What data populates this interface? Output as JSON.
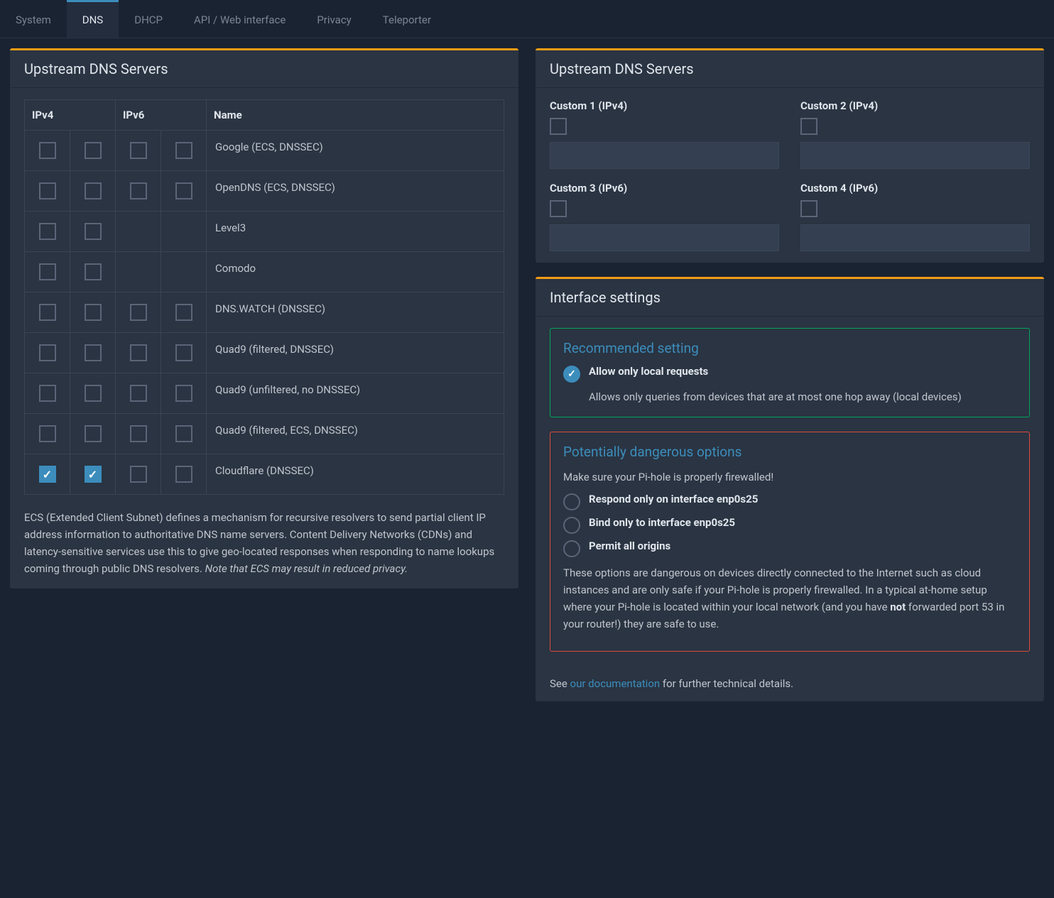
{
  "tabs": [
    {
      "label": "System",
      "active": false
    },
    {
      "label": "DNS",
      "active": true
    },
    {
      "label": "DHCP",
      "active": false
    },
    {
      "label": "API / Web interface",
      "active": false
    },
    {
      "label": "Privacy",
      "active": false
    },
    {
      "label": "Teleporter",
      "active": false
    }
  ],
  "upstream_card": {
    "title": "Upstream DNS Servers",
    "headers": {
      "ipv4": "IPv4",
      "ipv6": "IPv6",
      "name": "Name"
    },
    "providers": [
      {
        "name": "Google (ECS, DNSSEC)",
        "ipv4a": false,
        "ipv4b": false,
        "ipv6a": false,
        "ipv6b": false,
        "has_ipv6": true
      },
      {
        "name": "OpenDNS (ECS, DNSSEC)",
        "ipv4a": false,
        "ipv4b": false,
        "ipv6a": false,
        "ipv6b": false,
        "has_ipv6": true
      },
      {
        "name": "Level3",
        "ipv4a": false,
        "ipv4b": false,
        "has_ipv6": false
      },
      {
        "name": "Comodo",
        "ipv4a": false,
        "ipv4b": false,
        "has_ipv6": false
      },
      {
        "name": "DNS.WATCH (DNSSEC)",
        "ipv4a": false,
        "ipv4b": false,
        "ipv6a": false,
        "ipv6b": false,
        "has_ipv6": true
      },
      {
        "name": "Quad9 (filtered, DNSSEC)",
        "ipv4a": false,
        "ipv4b": false,
        "ipv6a": false,
        "ipv6b": false,
        "has_ipv6": true
      },
      {
        "name": "Quad9 (unfiltered, no DNSSEC)",
        "ipv4a": false,
        "ipv4b": false,
        "ipv6a": false,
        "ipv6b": false,
        "has_ipv6": true
      },
      {
        "name": "Quad9 (filtered, ECS, DNSSEC)",
        "ipv4a": false,
        "ipv4b": false,
        "ipv6a": false,
        "ipv6b": false,
        "has_ipv6": true
      },
      {
        "name": "Cloudflare (DNSSEC)",
        "ipv4a": true,
        "ipv4b": true,
        "ipv6a": false,
        "ipv6b": false,
        "has_ipv6": true
      }
    ],
    "ecs_text": "ECS (Extended Client Subnet) defines a mechanism for recursive resolvers to send partial client IP address information to authoritative DNS name servers. Content Delivery Networks (CDNs) and latency-sensitive services use this to give geo-located responses when responding to name lookups coming through public DNS resolvers. ",
    "ecs_em": "Note that ECS may result in reduced privacy."
  },
  "custom_card": {
    "title": "Upstream DNS Servers",
    "fields": [
      {
        "label": "Custom 1 (IPv4)",
        "checked": false,
        "value": ""
      },
      {
        "label": "Custom 2 (IPv4)",
        "checked": false,
        "value": ""
      },
      {
        "label": "Custom 3 (IPv6)",
        "checked": false,
        "value": ""
      },
      {
        "label": "Custom 4 (IPv6)",
        "checked": false,
        "value": ""
      }
    ]
  },
  "interface_card": {
    "title": "Interface settings",
    "recommended": {
      "heading": "Recommended setting",
      "option_label": "Allow only local requests",
      "option_desc": "Allows only queries from devices that are at most one hop away (local devices)",
      "checked": true
    },
    "dangerous": {
      "heading": "Potentially dangerous options",
      "warning": "Make sure your Pi-hole is properly firewalled!",
      "options": [
        {
          "label": "Respond only on interface enp0s25",
          "checked": false
        },
        {
          "label": "Bind only to interface enp0s25",
          "checked": false
        },
        {
          "label": "Permit all origins",
          "checked": false
        }
      ],
      "desc_pre": "These options are dangerous on devices directly connected to the Internet such as cloud instances and are only safe if your Pi-hole is properly firewalled. In a typical at-home setup where your Pi-hole is located within your local network (and you have ",
      "desc_strong": "not",
      "desc_post": " forwarded port 53 in your router!) they are safe to use."
    },
    "doc_pre": "See ",
    "doc_link": "our documentation",
    "doc_post": " for further technical details."
  }
}
